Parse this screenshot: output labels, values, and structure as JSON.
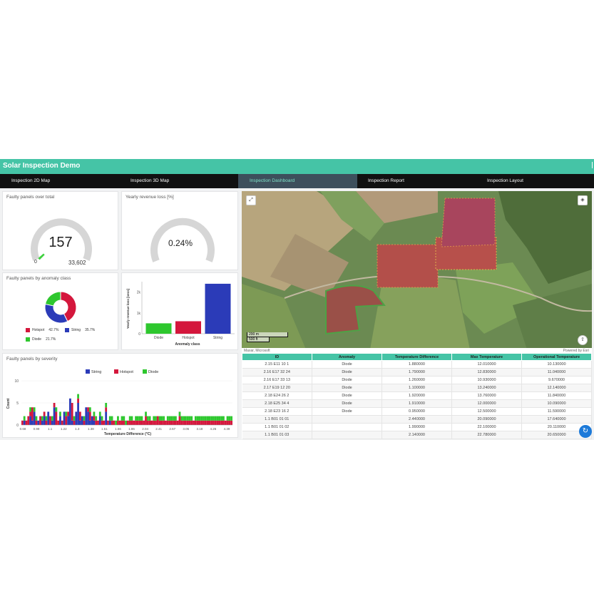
{
  "app": {
    "title": "Solar Inspection Demo"
  },
  "tabs": [
    {
      "label": "Inspection 2D Map",
      "active": false
    },
    {
      "label": "Inspection 3D Map",
      "active": false
    },
    {
      "label": "Inspection Dashboard",
      "active": true
    },
    {
      "label": "Inspection Report",
      "active": false
    },
    {
      "label": "Inspection Layout",
      "active": false
    }
  ],
  "gauge_faulty": {
    "title": "Faulty panels over total",
    "value": "157",
    "min": "0",
    "max": "33,602",
    "fill_fraction": 0.005
  },
  "gauge_revenue": {
    "title": "Yearly revenue loss [%]",
    "value": "0.24%",
    "fill_fraction": 0.0024
  },
  "donut": {
    "title": "Faulty panels by anomaly class",
    "legend": [
      {
        "label": "Hotspot",
        "value": "42.7%",
        "color": "#d4173c"
      },
      {
        "label": "String",
        "value": "35.7%",
        "color": "#2b3bb8"
      },
      {
        "label": "Diode",
        "value": "21.7%",
        "color": "#2ec72e"
      }
    ]
  },
  "bar_chart": {
    "ylabel": "Yearly revenue loss [secs]",
    "xlabel": "Anomaly class",
    "yticks": [
      "2k",
      "1k",
      "0"
    ]
  },
  "histogram": {
    "title": "Faulty panels by severity",
    "legend": [
      {
        "label": "String",
        "color": "#2b3bb8"
      },
      {
        "label": "Hotspot",
        "color": "#d4173c"
      },
      {
        "label": "Diode",
        "color": "#2ec72e"
      }
    ],
    "ylabel": "Count",
    "xlabel": "Temperature Difference (°C)",
    "yticks": [
      "10",
      "5",
      "0"
    ],
    "xticks": [
      "0.68",
      "0.99",
      "1.1",
      "1.22",
      "1.3",
      "1.38",
      "1.51",
      "1.66",
      "1.86",
      "2.04",
      "2.41",
      "2.67",
      "3.05",
      "3.18",
      "4.26",
      "4.39"
    ]
  },
  "map": {
    "compass_label": "⇧",
    "scale_top": "200 m",
    "scale_bottom": "500 ft",
    "attribution_left": "Maxar, Microsoft",
    "attribution_right": "Powered by Esri"
  },
  "table": {
    "headers": [
      "ID",
      "Anomaly",
      "Temperature Difference",
      "Max Temperature",
      "Operational Temperature"
    ],
    "rows": [
      [
        "2.15 E11 10 1",
        "Diode",
        "1.880000",
        "12.010000",
        "10.130000"
      ],
      [
        "2.16 E17 32 24",
        "Diode",
        "1.790000",
        "12.830000",
        "11.040000"
      ],
      [
        "2.16 E17 33 13",
        "Diode",
        "1.260000",
        "10.930000",
        "9.670000"
      ],
      [
        "2.17 E19 12 20",
        "Diode",
        "1.100000",
        "13.240000",
        "12.140000"
      ],
      [
        "2.18 E24 26 2",
        "Diode",
        "1.920000",
        "13.760000",
        "11.840000"
      ],
      [
        "2.18 E25 34 4",
        "Diode",
        "1.910000",
        "12.000000",
        "10.090000"
      ],
      [
        "2.18 E23 16 2",
        "Diode",
        "0.950000",
        "12.500000",
        "11.590000"
      ],
      [
        "1.1 B01 01 01",
        "",
        "2.440000",
        "20.090000",
        "17.640000"
      ],
      [
        "1.1 B01 01 02",
        "",
        "1.990000",
        "22.100000",
        "20.110000"
      ],
      [
        "1.1 B01 01 03",
        "",
        "2.140000",
        "22.780000",
        "20.650000"
      ]
    ]
  },
  "chart_data": [
    {
      "type": "pie",
      "title": "Faulty panels by anomaly class",
      "categories": [
        "Hotspot",
        "String",
        "Diode"
      ],
      "values": [
        42.7,
        35.7,
        21.7
      ],
      "donut": true
    },
    {
      "type": "bar",
      "xlabel": "Anomaly class",
      "ylabel": "Yearly revenue loss [secs]",
      "categories": [
        "Diode",
        "Hotspot",
        "String"
      ],
      "values": [
        500,
        600,
        2400
      ],
      "colors": [
        "#2ec72e",
        "#d4173c",
        "#2b3bb8"
      ],
      "ylim": [
        0,
        2500
      ]
    },
    {
      "type": "bar",
      "title": "Faulty panels by severity",
      "xlabel": "Temperature Difference (°C)",
      "ylabel": "Count",
      "ylim": [
        0,
        10
      ],
      "series": [
        {
          "name": "String",
          "color": "#2b3bb8",
          "values": [
            0,
            1,
            0,
            0,
            2,
            1,
            3,
            0,
            1,
            0,
            1,
            2,
            0,
            3,
            0,
            1,
            4,
            0,
            0,
            2,
            0,
            3,
            0,
            2,
            6,
            1,
            0,
            3,
            5,
            1,
            2,
            0,
            4,
            3,
            1,
            2,
            1,
            0,
            0,
            2,
            0,
            0,
            3,
            0,
            1,
            0,
            0,
            0,
            0,
            0,
            0,
            0,
            0,
            0,
            0,
            0,
            0,
            0,
            0,
            0,
            0,
            0,
            0,
            0,
            0,
            0,
            0,
            0,
            0,
            0,
            0,
            0,
            0,
            0,
            0,
            0,
            0,
            0,
            0,
            0,
            0,
            0,
            0,
            0,
            0,
            0,
            0,
            0,
            0,
            0,
            0,
            0,
            0,
            0,
            0,
            0,
            0,
            0,
            0,
            0,
            0,
            0,
            0,
            0,
            0,
            0
          ]
        },
        {
          "name": "Hotspot",
          "color": "#d4173c",
          "values": [
            1,
            0,
            1,
            2,
            1,
            3,
            0,
            1,
            0,
            2,
            0,
            1,
            1,
            0,
            2,
            0,
            1,
            3,
            1,
            0,
            1,
            0,
            2,
            1,
            0,
            4,
            1,
            0,
            1,
            2,
            0,
            1,
            0,
            1,
            2,
            0,
            1,
            1,
            1,
            0,
            1,
            1,
            1,
            1,
            0,
            1,
            1,
            0,
            1,
            1,
            1,
            1,
            0,
            1,
            1,
            1,
            1,
            1,
            1,
            1,
            1,
            1,
            2,
            1,
            1,
            1,
            1,
            1,
            2,
            1,
            1,
            1,
            1,
            1,
            1,
            1,
            1,
            1,
            1,
            2,
            1,
            1,
            1,
            1,
            1,
            1,
            1,
            1,
            1,
            1,
            1,
            1,
            1,
            1,
            1,
            1,
            1,
            1,
            1,
            1,
            1,
            1,
            1,
            1,
            1,
            1
          ]
        },
        {
          "name": "Diode",
          "color": "#2ec72e",
          "values": [
            0,
            1,
            0,
            0,
            1,
            0,
            1,
            1,
            0,
            0,
            1,
            0,
            1,
            0,
            0,
            1,
            0,
            1,
            0,
            1,
            0,
            0,
            1,
            0,
            0,
            0,
            1,
            0,
            1,
            0,
            0,
            1,
            0,
            0,
            1,
            0,
            1,
            1,
            0,
            1,
            1,
            0,
            1,
            0,
            1,
            1,
            0,
            1,
            1,
            0,
            1,
            1,
            1,
            0,
            1,
            1,
            0,
            1,
            1,
            1,
            1,
            0,
            1,
            1,
            1,
            0,
            1,
            1,
            0,
            1,
            1,
            1,
            0,
            1,
            1,
            1,
            1,
            1,
            0,
            1,
            1,
            1,
            1,
            1,
            1,
            1,
            0,
            1,
            1,
            1,
            1,
            1,
            1,
            1,
            1,
            1,
            1,
            1,
            1,
            1,
            1,
            1,
            0,
            1,
            1,
            1
          ]
        }
      ]
    }
  ]
}
